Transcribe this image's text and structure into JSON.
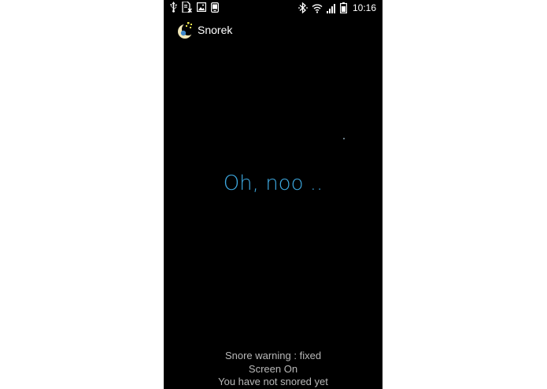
{
  "status_bar": {
    "time": "10:16",
    "icons_left": [
      "usb-icon",
      "sim-card-icon",
      "image-icon",
      "phone-icon"
    ],
    "icons_right": [
      "bluetooth-icon",
      "wifi-icon",
      "signal-icon",
      "battery-icon"
    ]
  },
  "app": {
    "title": "Snorek"
  },
  "main": {
    "message": "Oh, noo .."
  },
  "footer": {
    "line1": "Snore warning : fixed",
    "line2": "Screen On",
    "line3": "You have not snored yet"
  },
  "colors": {
    "background": "#000000",
    "message": "#3da8e0",
    "footer_text": "#b8b8b8"
  }
}
